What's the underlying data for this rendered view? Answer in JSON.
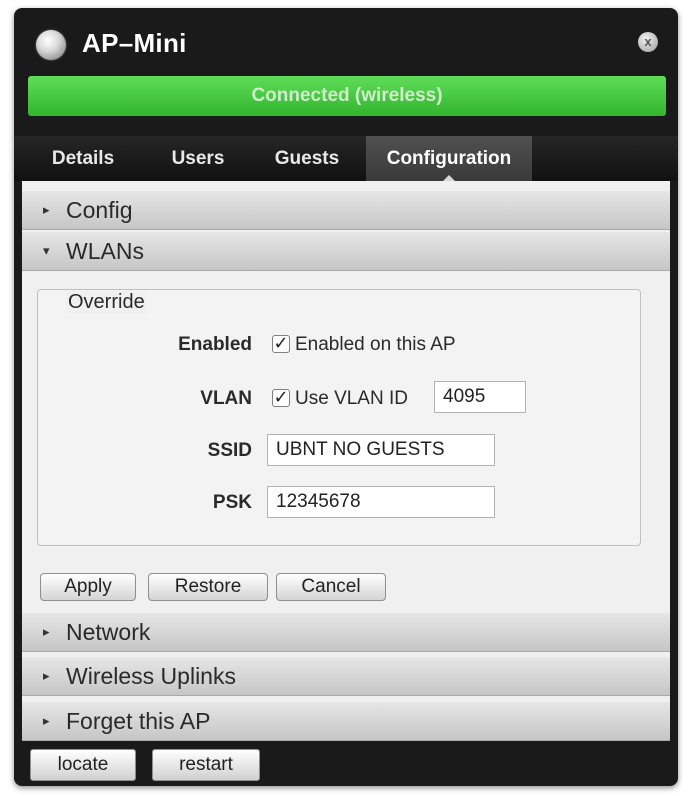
{
  "window": {
    "title": "AP–Mini",
    "status": "Connected (wireless)",
    "status_color": "#3cc136",
    "close_icon": "x"
  },
  "tabs": [
    {
      "label": "Details",
      "active": false
    },
    {
      "label": "Users",
      "active": false
    },
    {
      "label": "Guests",
      "active": false
    },
    {
      "label": "Configuration",
      "active": true
    }
  ],
  "sections": {
    "config": {
      "label": "Config",
      "expanded": false,
      "arrow": "▸"
    },
    "wlans": {
      "label": "WLANs",
      "expanded": true,
      "arrow": "▾"
    },
    "network": {
      "label": "Network",
      "expanded": false,
      "arrow": "▸"
    },
    "wireless_uplinks": {
      "label": "Wireless Uplinks",
      "expanded": false,
      "arrow": "▸"
    },
    "forget": {
      "label": "Forget this AP",
      "expanded": false,
      "arrow": "▸"
    }
  },
  "override": {
    "legend": "Override",
    "enabled": {
      "label": "Enabled",
      "checkbox_text": "Enabled on this AP",
      "checked": true
    },
    "vlan": {
      "label": "VLAN",
      "checkbox_text": "Use VLAN ID",
      "checked": true,
      "value": "4095"
    },
    "ssid": {
      "label": "SSID",
      "value": "UBNT NO GUESTS"
    },
    "psk": {
      "label": "PSK",
      "value": "12345678"
    }
  },
  "actions": {
    "apply": "Apply",
    "restore": "Restore",
    "cancel": "Cancel"
  },
  "footer": {
    "locate": "locate",
    "restart": "restart"
  }
}
